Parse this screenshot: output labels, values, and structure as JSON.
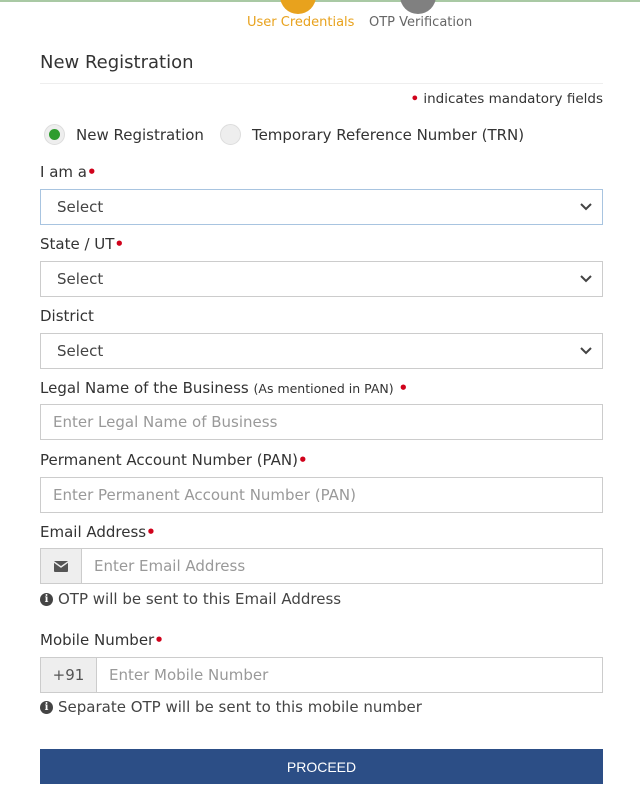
{
  "steps": [
    {
      "label": "User Credentials",
      "state": "active",
      "color": "#e8a21d"
    },
    {
      "label": "OTP Verification",
      "state": "inactive",
      "color": "#808080"
    }
  ],
  "form": {
    "title": "New Registration",
    "mandatory_note": "indicates mandatory fields",
    "required_marker": "•",
    "registration_type": {
      "options": [
        {
          "label": "New Registration",
          "selected": true
        },
        {
          "label": "Temporary Reference Number (TRN)",
          "selected": false
        }
      ]
    },
    "i_am_a": {
      "label": "I am a",
      "value": "Select",
      "required": true
    },
    "state": {
      "label": "State / UT",
      "value": "Select",
      "required": true
    },
    "district": {
      "label": "District",
      "value": "Select",
      "required": false
    },
    "legal_name": {
      "label": "Legal Name of the Business",
      "hint": "(As mentioned in PAN)",
      "placeholder": "Enter Legal Name of Business",
      "required": true
    },
    "pan": {
      "label": "Permanent Account Number (PAN)",
      "placeholder": "Enter Permanent Account Number (PAN)",
      "required": true
    },
    "email": {
      "label": "Email Address",
      "placeholder": "Enter Email Address",
      "help": "OTP will be sent to this Email Address",
      "required": true
    },
    "mobile": {
      "label": "Mobile Number",
      "prefix": "+91",
      "placeholder": "Enter Mobile Number",
      "help": "Separate OTP will be sent to this mobile number",
      "required": true
    },
    "proceed_label": "PROCEED"
  },
  "colors": {
    "primary": "#2c4e86",
    "required": "#d0021b",
    "radio_selected": "#2e9c2e"
  }
}
